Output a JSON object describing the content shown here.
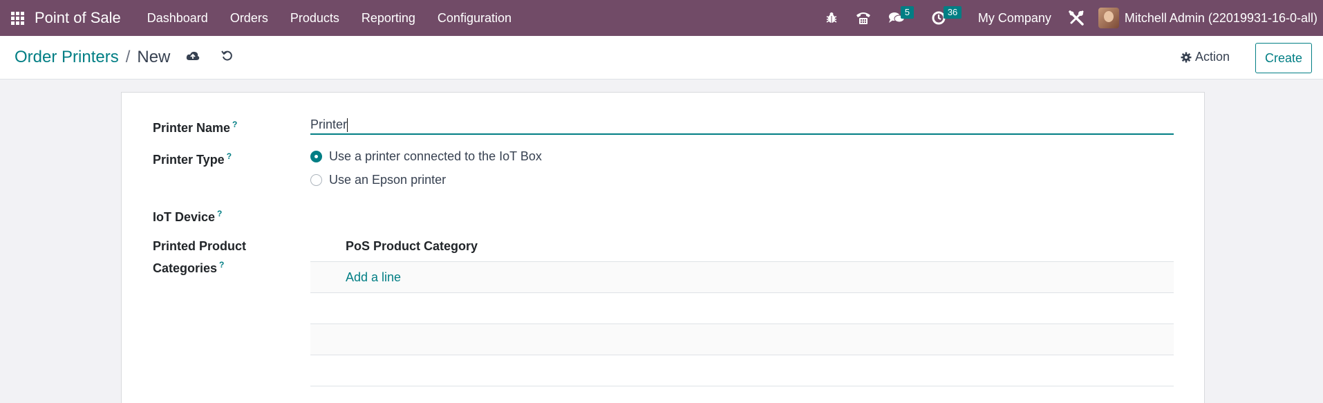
{
  "navbar": {
    "brand": "Point of Sale",
    "menu": [
      "Dashboard",
      "Orders",
      "Products",
      "Reporting",
      "Configuration"
    ],
    "icons": [
      "apps-grid-icon",
      "bug-icon",
      "phone-icon",
      "chat-icon",
      "clock-icon",
      "tools-icon"
    ],
    "messages_badge": "5",
    "activities_badge": "36",
    "company": "My Company",
    "user": "Mitchell Admin (22019931-16-0-all)",
    "color": "#714b67"
  },
  "control_panel": {
    "breadcrumb_parent": "Order Printers",
    "breadcrumb_separator": "/",
    "breadcrumb_current": "New",
    "action_label": "Action",
    "create_label": "Create"
  },
  "form": {
    "printer_name_label": "Printer Name",
    "printer_name_value": "Printer",
    "printer_type_label": "Printer Type",
    "printer_type_options": [
      "Use a printer connected to the IoT Box",
      "Use an Epson printer"
    ],
    "printer_type_selected": "Use a printer connected to the IoT Box",
    "iot_device_label": "IoT Device",
    "categories_label_line1": "Printed Product",
    "categories_label_line2": "Categories",
    "help_marker": "?",
    "table_header": "PoS Product Category",
    "add_line": "Add a line"
  },
  "accent_color": "#017e84"
}
